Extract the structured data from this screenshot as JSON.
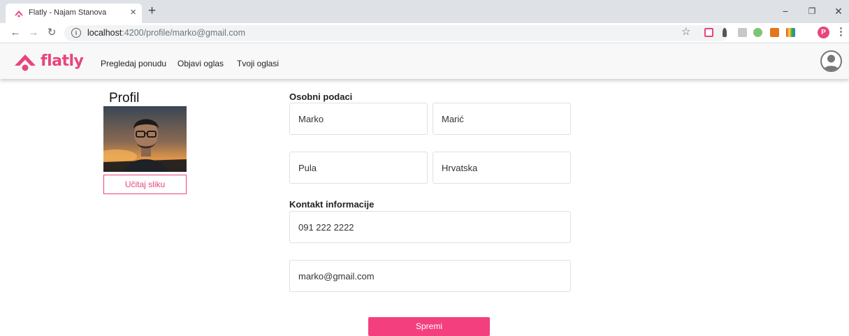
{
  "browser": {
    "tab_title": "Flatly - Najam Stanova",
    "url_host": "localhost",
    "url_path": ":4200/profile/marko@gmail.com",
    "profile_initial": "P"
  },
  "navbar": {
    "brand": "flatly",
    "links": [
      "Pregledaj ponudu",
      "Objavi oglas",
      "Tvoji oglasi"
    ]
  },
  "profile": {
    "title": "Profil",
    "upload_label": "Učitaj sliku"
  },
  "form": {
    "personal_label": "Osobni podaci",
    "first_name": "Marko",
    "last_name": "Marić",
    "city": "Pula",
    "country": "Hrvatska",
    "contact_label": "Kontakt informacije",
    "phone": "091 222 2222",
    "email": "marko@gmail.com",
    "save_label": "Spremi"
  },
  "colors": {
    "accent": "#e8457c",
    "save_button": "#f43f7f"
  }
}
